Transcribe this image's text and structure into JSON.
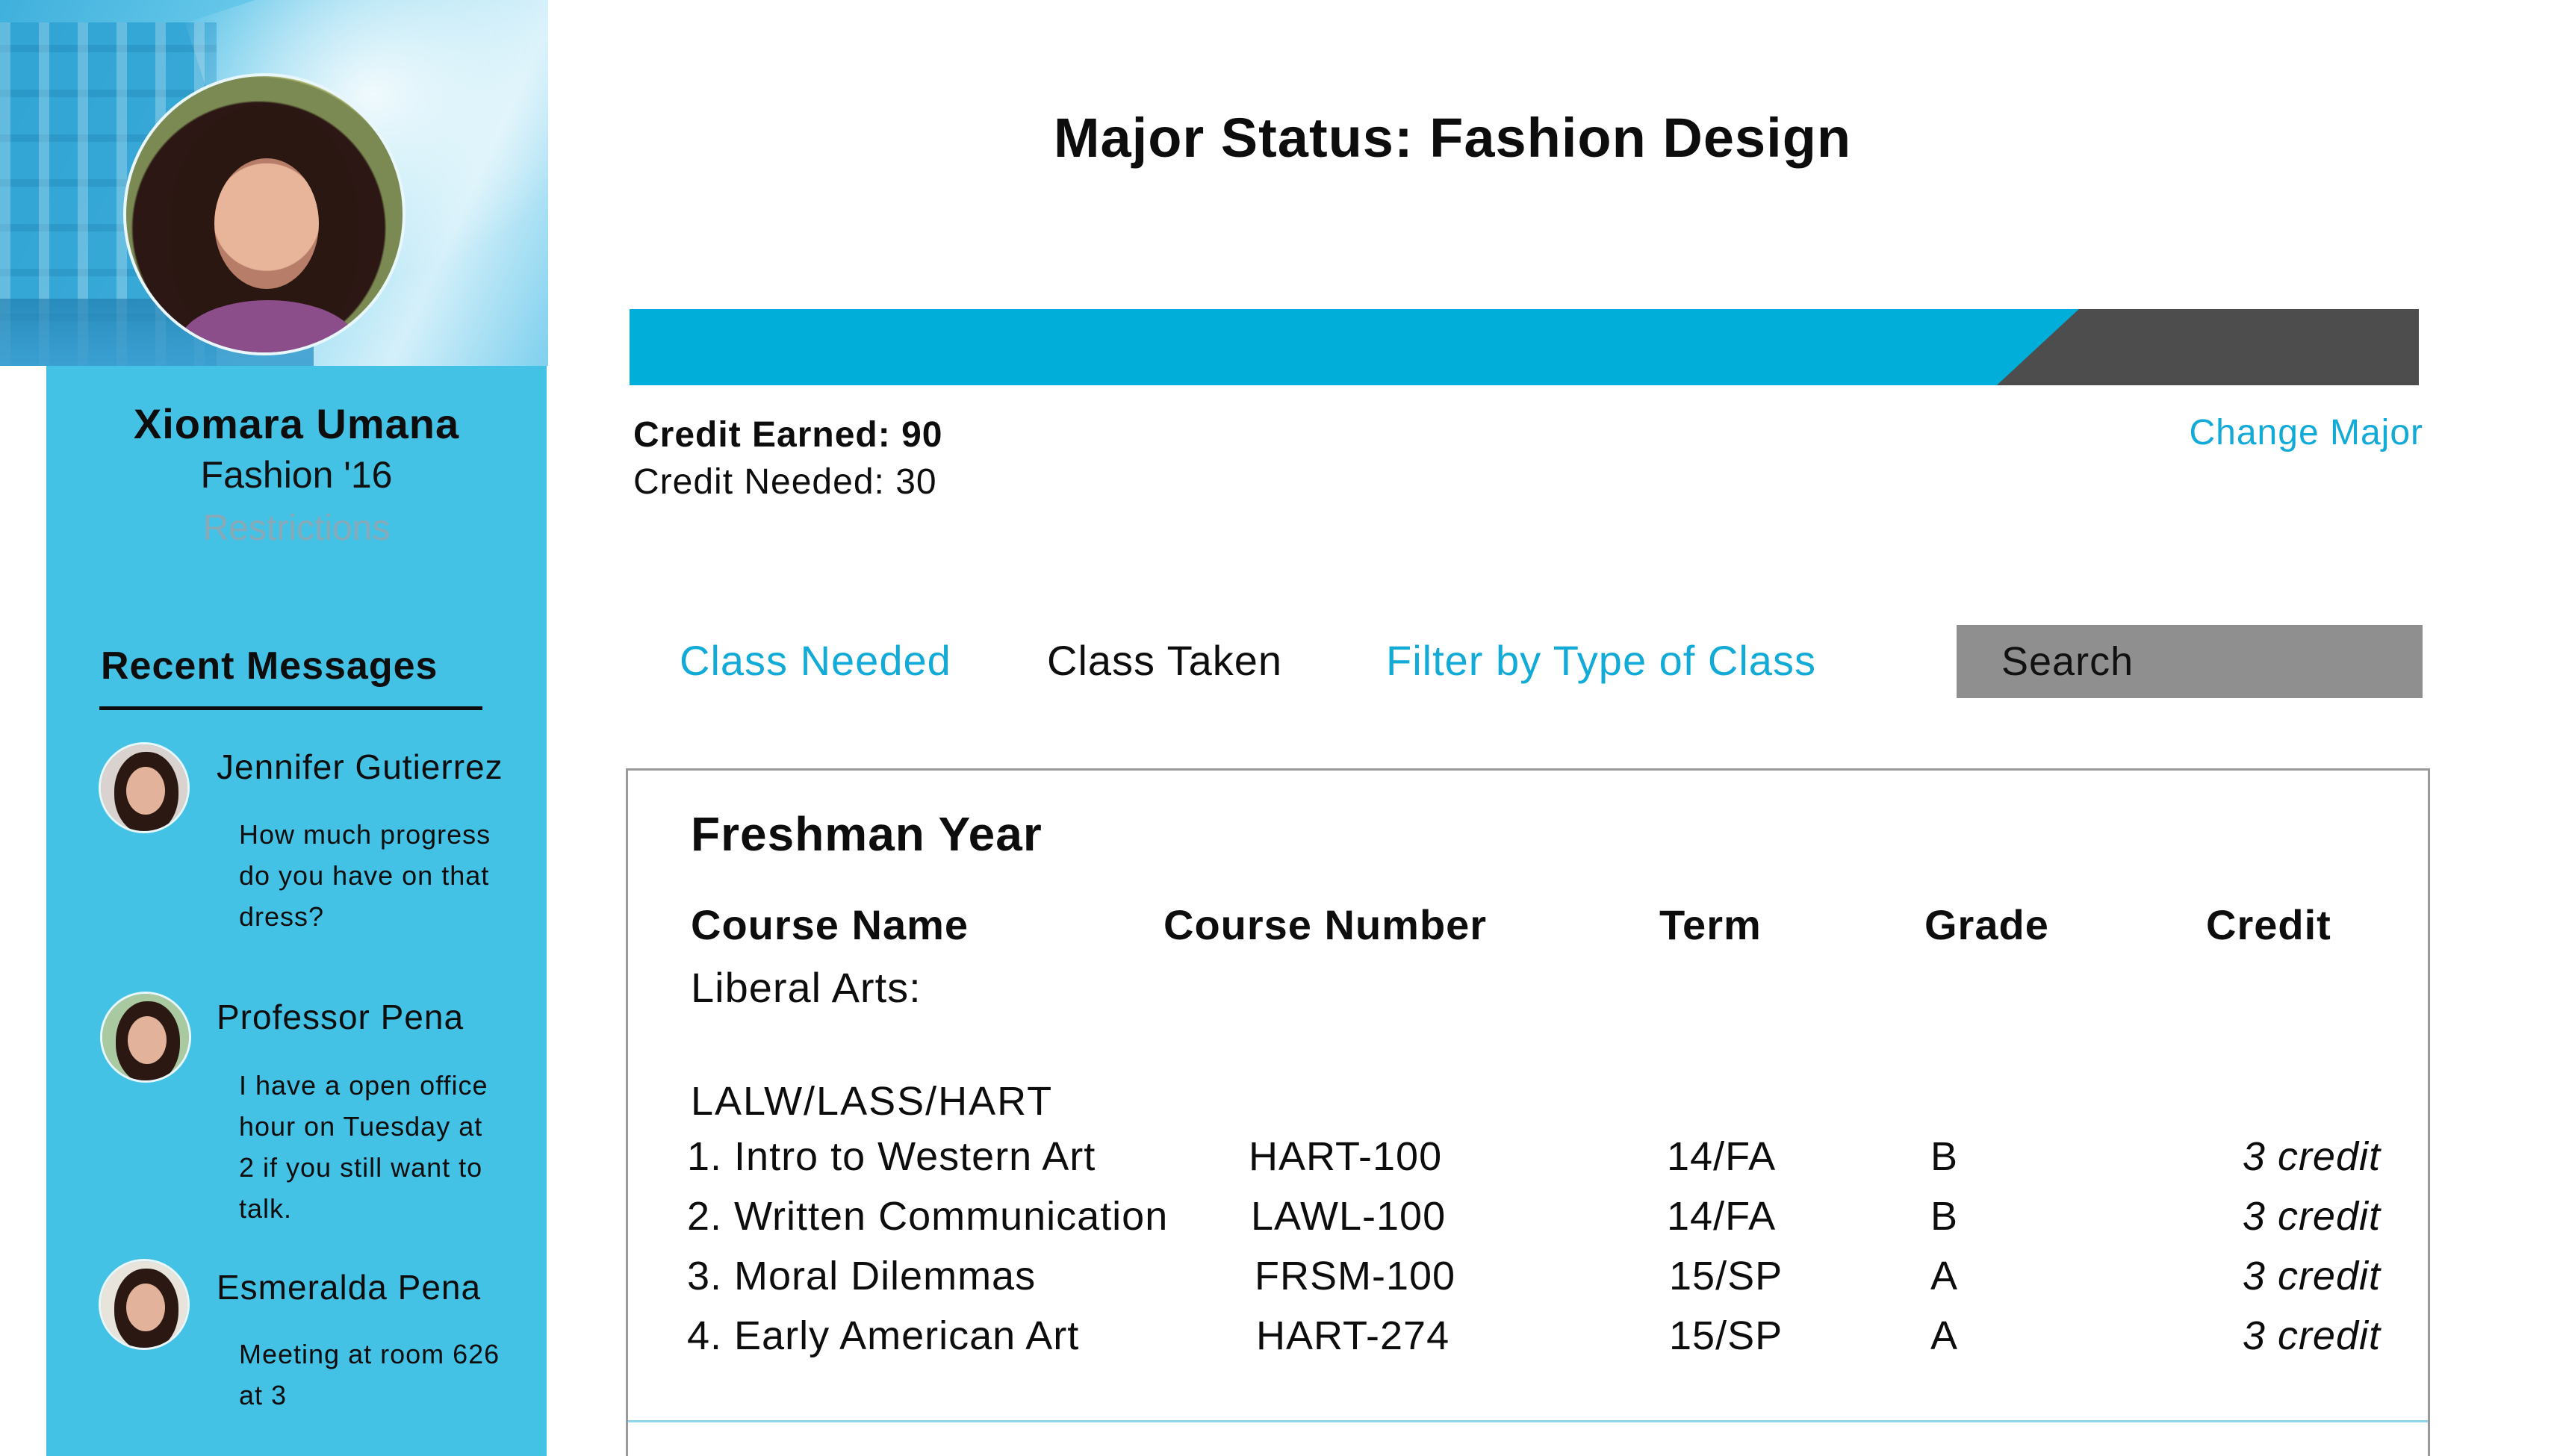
{
  "user": {
    "name": "Xiomara Umana",
    "program": "Fashion '16",
    "restrictions_link": "Restrictions"
  },
  "messages": {
    "title": "Recent Messages",
    "items": [
      {
        "name": "Jennifer Gutierrez",
        "lines": [
          "How much progress",
          "do you have on that",
          "dress?"
        ]
      },
      {
        "name": "Professor Pena",
        "lines": [
          "I have a open office",
          "hour on Tuesday at",
          "2 if you still want to",
          "talk."
        ]
      },
      {
        "name": "Esmeralda Pena",
        "lines": [
          "Meeting at room 626",
          "at 3"
        ]
      }
    ]
  },
  "main": {
    "title": "Major Status: Fashion Design",
    "credit_earned": "Credit Earned: 90",
    "credit_needed": "Credit Needed:  30",
    "change_major": "Change Major",
    "progress_fraction": 0.81
  },
  "tabs": {
    "class_needed": "Class Needed",
    "class_taken": "Class Taken",
    "filter": "Filter by Type of Class",
    "search_placeholder": "Search"
  },
  "table": {
    "year": "Freshman Year",
    "columns": [
      "Course Name",
      "Course Number",
      "Term",
      "Grade",
      "Credit"
    ],
    "section": "Liberal Arts:",
    "group": "LALW/LASS/HART",
    "rows": [
      {
        "name": "1.  Intro to Western Art",
        "number": "HART-100",
        "term": "14/FA",
        "grade": "B",
        "credit": "3 credit"
      },
      {
        "name": "2. Written Communication",
        "number": "LAWL-100",
        "term": "14/FA",
        "grade": "B",
        "credit": "3 credit"
      },
      {
        "name": "3. Moral Dilemmas",
        "number": "FRSM-100",
        "term": "15/SP",
        "grade": "A",
        "credit": "3 credit"
      },
      {
        "name": "4. Early American Art",
        "number": "HART-274",
        "term": "15/SP",
        "grade": "A",
        "credit": "3 credit"
      }
    ]
  },
  "colors": {
    "sidebar": "#44c2e6",
    "accent": "#00afd9",
    "link": "#12aad6",
    "progress_track": "#4d4d4d",
    "search_bg": "#8f8f8f"
  }
}
